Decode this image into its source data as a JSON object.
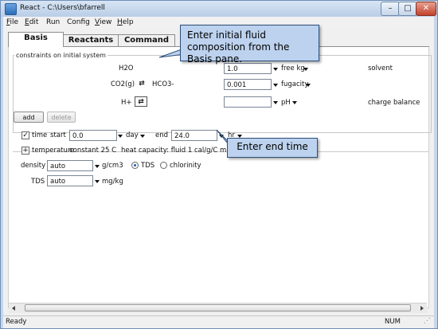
{
  "window": {
    "title": "React - C:\\Users\\bfarrell",
    "controls": {
      "minimize": "–",
      "maximize": "□",
      "close": "✕"
    }
  },
  "menu": [
    {
      "u": "F",
      "rest": "ile"
    },
    {
      "u": "E",
      "rest": "dit"
    },
    {
      "u": "",
      "rest": "Run"
    },
    {
      "u": "",
      "rest": "Config"
    },
    {
      "u": "V",
      "rest": "iew"
    },
    {
      "u": "H",
      "rest": "elp"
    }
  ],
  "tabs": [
    "Basis",
    "Reactants",
    "Command"
  ],
  "constraints": {
    "group_label": "constraints on initial system",
    "rows": [
      {
        "species": "H2O",
        "swap_species": "",
        "value": "1.0",
        "unit": "free kg",
        "note": "solvent"
      },
      {
        "species": "CO2(g)",
        "swap_species": "HCO3-",
        "value": "0.001",
        "unit": "fugacity",
        "note": ""
      },
      {
        "species": "H+",
        "swap_species": "",
        "value": "",
        "unit": "pH",
        "note": "charge balance"
      }
    ],
    "add": "add",
    "delete": "delete"
  },
  "time": {
    "label": "time",
    "start_label": "start",
    "start": "0.0",
    "start_unit": "day",
    "end_label": "end",
    "end": "24.0",
    "end_unit": "hr",
    "checked": true
  },
  "temperature": {
    "label": "temperature",
    "value": "constant 25 C",
    "heat_capacity": "heat capacity:  fluid 1 cal/g/C   minerals"
  },
  "density": {
    "label": "density",
    "value": "auto",
    "unit": "g/cm3",
    "opt_tds": "TDS",
    "opt_chlorinity": "chlorinity",
    "selected": "TDS"
  },
  "tds": {
    "label": "TDS",
    "value": "auto",
    "unit": "mg/kg"
  },
  "status": {
    "left": "Ready",
    "right": "NUM"
  },
  "callouts": {
    "basis": "Enter initial fluid composition from the Basis pane.",
    "end_time": "Enter end time"
  },
  "icons": [
    "app-icon",
    "swap-icon",
    "dropdown-arrow-icon",
    "scroll-left-icon",
    "scroll-right-icon",
    "grip-icon"
  ]
}
